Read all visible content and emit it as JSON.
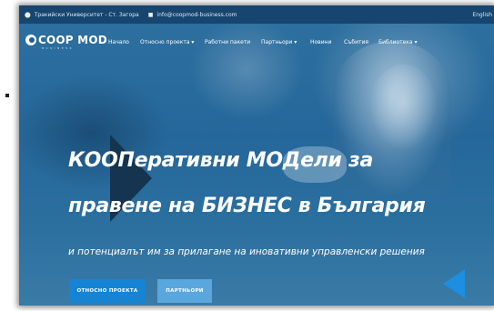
{
  "topbar": {
    "address": "Тракийски Университет - Ст. Загора",
    "email": "info@coopmod-business.com",
    "language": "English",
    "location_icon": "location-pin-icon",
    "mail_icon": "mail-icon"
  },
  "logo": {
    "name": "COOP MOD",
    "tagline": "BUSINESS"
  },
  "nav": {
    "items": [
      {
        "label": "Начало"
      },
      {
        "label": "Относно проекта ▾"
      },
      {
        "label": "Работни пакети"
      },
      {
        "label": "Партньори ▾"
      },
      {
        "label": "Новини"
      },
      {
        "label": "Събития"
      },
      {
        "label": "Библиотека ▾"
      }
    ]
  },
  "hero": {
    "headline_line1": "КООПеративни МОДели за",
    "headline_line2": "правене на БИЗНЕС в България",
    "subtitle": "и потенциалът им за прилагане на иновативни управленски решения",
    "primary_button": "ОТНОСНО ПРОЕКТА",
    "secondary_button": "ПАРТНЬОРИ"
  },
  "colors": {
    "topbar": "#16456f",
    "hero_blue": "#2b6f9f",
    "button_primary": "#1584d4",
    "button_secondary": "#5aa7dd"
  }
}
